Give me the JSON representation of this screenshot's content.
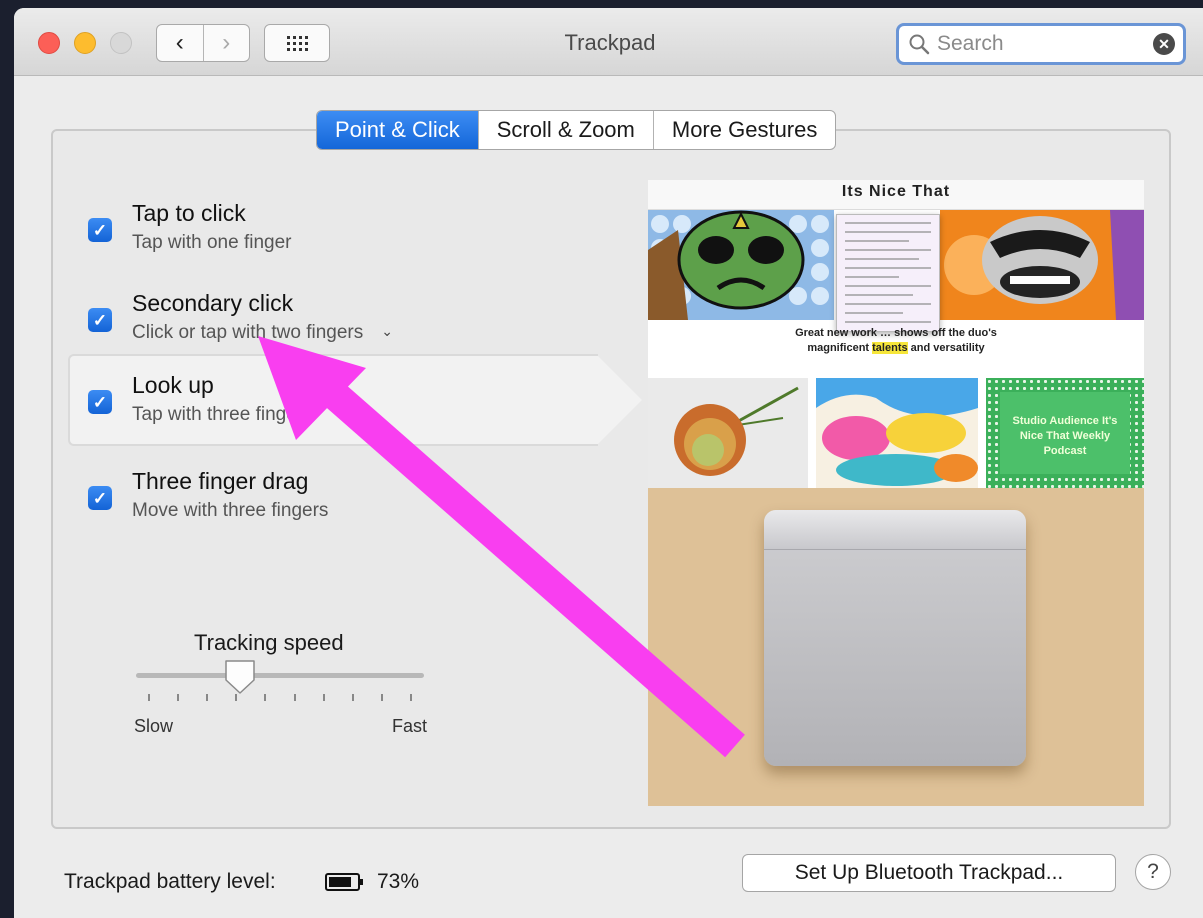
{
  "window": {
    "title": "Trackpad",
    "nav_back_icon": "chevron-left-icon",
    "nav_forward_icon": "chevron-right-icon",
    "show_all_icon": "grid-icon"
  },
  "search": {
    "placeholder": "Search",
    "clear_icon": "clear-icon"
  },
  "tabs": [
    {
      "label": "Point & Click",
      "active": true
    },
    {
      "label": "Scroll & Zoom",
      "active": false
    },
    {
      "label": "More Gestures",
      "active": false
    }
  ],
  "options": [
    {
      "title": "Tap to click",
      "subtitle": "Tap with one finger",
      "checked": true
    },
    {
      "title": "Secondary click",
      "subtitle": "Click or tap with two fingers",
      "checked": true,
      "has_menu": true
    },
    {
      "title": "Look up",
      "subtitle": "Tap with three fingers",
      "checked": true,
      "selected": true
    },
    {
      "title": "Three finger drag",
      "subtitle": "Move with three fingers",
      "checked": true
    }
  ],
  "tracking_speed": {
    "label": "Tracking speed",
    "min_label": "Slow",
    "max_label": "Fast",
    "tick_count": 10,
    "value_position": 0.35
  },
  "preview": {
    "site_title": "Its Nice That",
    "caption_line1": "Great new work … shows off the duo's",
    "caption_line2_before": "magnificent ",
    "caption_highlight": "talents",
    "caption_line2_after": " and versatility",
    "thumb_text": "Studio Audience It's Nice That Weekly Podcast"
  },
  "footer": {
    "battery_label": "Trackpad battery level:",
    "battery_icon": "battery-icon",
    "battery_percent": "73%",
    "bluetooth_button": "Set Up Bluetooth Trackpad...",
    "help_label": "?"
  },
  "colors": {
    "accent": "#1467d9",
    "annotation_arrow": "#f93ef0",
    "close": "#fc5f57",
    "minimize": "#fdbc2e"
  }
}
